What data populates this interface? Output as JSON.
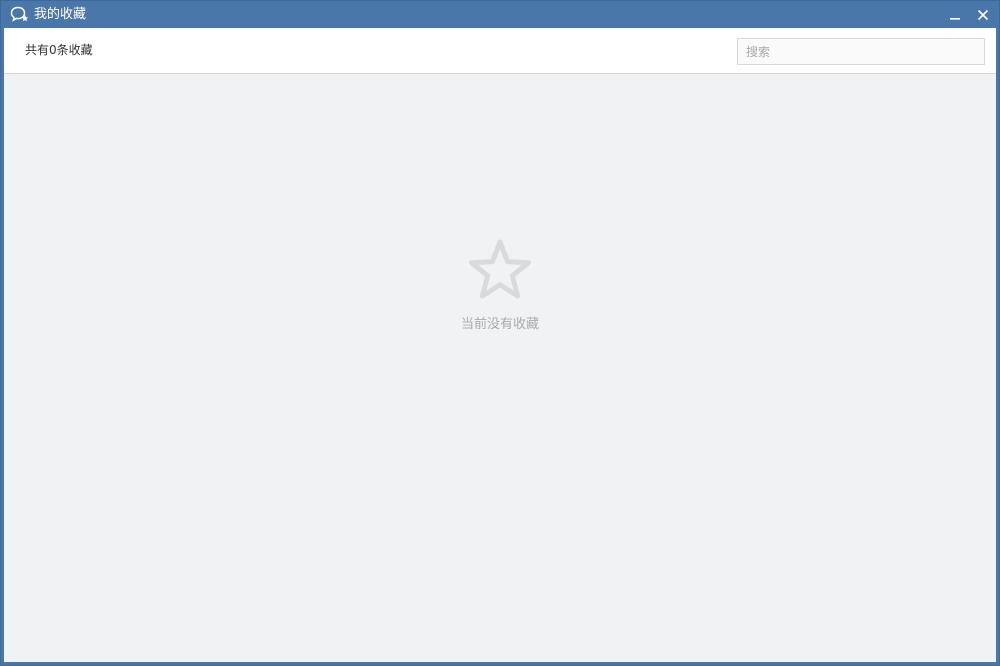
{
  "window": {
    "title": "我的收藏",
    "title_icon": "chat-star-icon",
    "minimize_icon": "minimize-icon",
    "close_icon": "close-icon"
  },
  "toolbar": {
    "count_label": "共有0条收藏",
    "search": {
      "placeholder": "搜索",
      "value": ""
    }
  },
  "empty_state": {
    "icon": "star-outline-icon",
    "message": "当前没有收藏"
  },
  "colors": {
    "title_bar": "#4a77a9",
    "content_background": "#f1f2f4",
    "empty_icon": "#d9dadc",
    "empty_text": "#a9abae"
  }
}
